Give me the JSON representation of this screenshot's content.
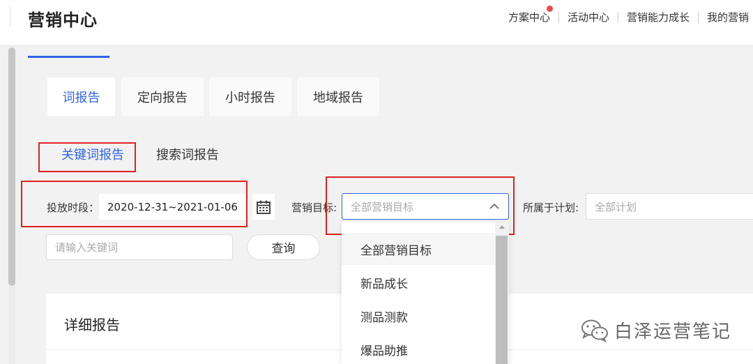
{
  "header": {
    "title": "营销中心",
    "nav": [
      "方案中心",
      "活动中心",
      "营销能力成长",
      "我的营销"
    ]
  },
  "tabs": [
    "词报告",
    "定向报告",
    "小时报告",
    "地域报告"
  ],
  "subtabs": [
    "关键词报告",
    "搜索词报告"
  ],
  "filters": {
    "period_label": "投放时段：",
    "period_value": "2020-12-31~2021-01-06",
    "goal_label": "营销目标:",
    "goal_placeholder": "全部营销目标",
    "plan_label": "所属于计划:",
    "plan_placeholder": "全部计划",
    "keyword_placeholder": "请输入关键词",
    "query_label": "查询"
  },
  "dropdown": {
    "options": [
      "全部营销目标",
      "新品成长",
      "测品测款",
      "爆品助推"
    ]
  },
  "report": {
    "title": "详细报告"
  },
  "watermark": {
    "text": "白泽运营笔记"
  },
  "colors": {
    "accent": "#2f62e6",
    "highlight": "#e02020",
    "notification": "#f04848"
  }
}
